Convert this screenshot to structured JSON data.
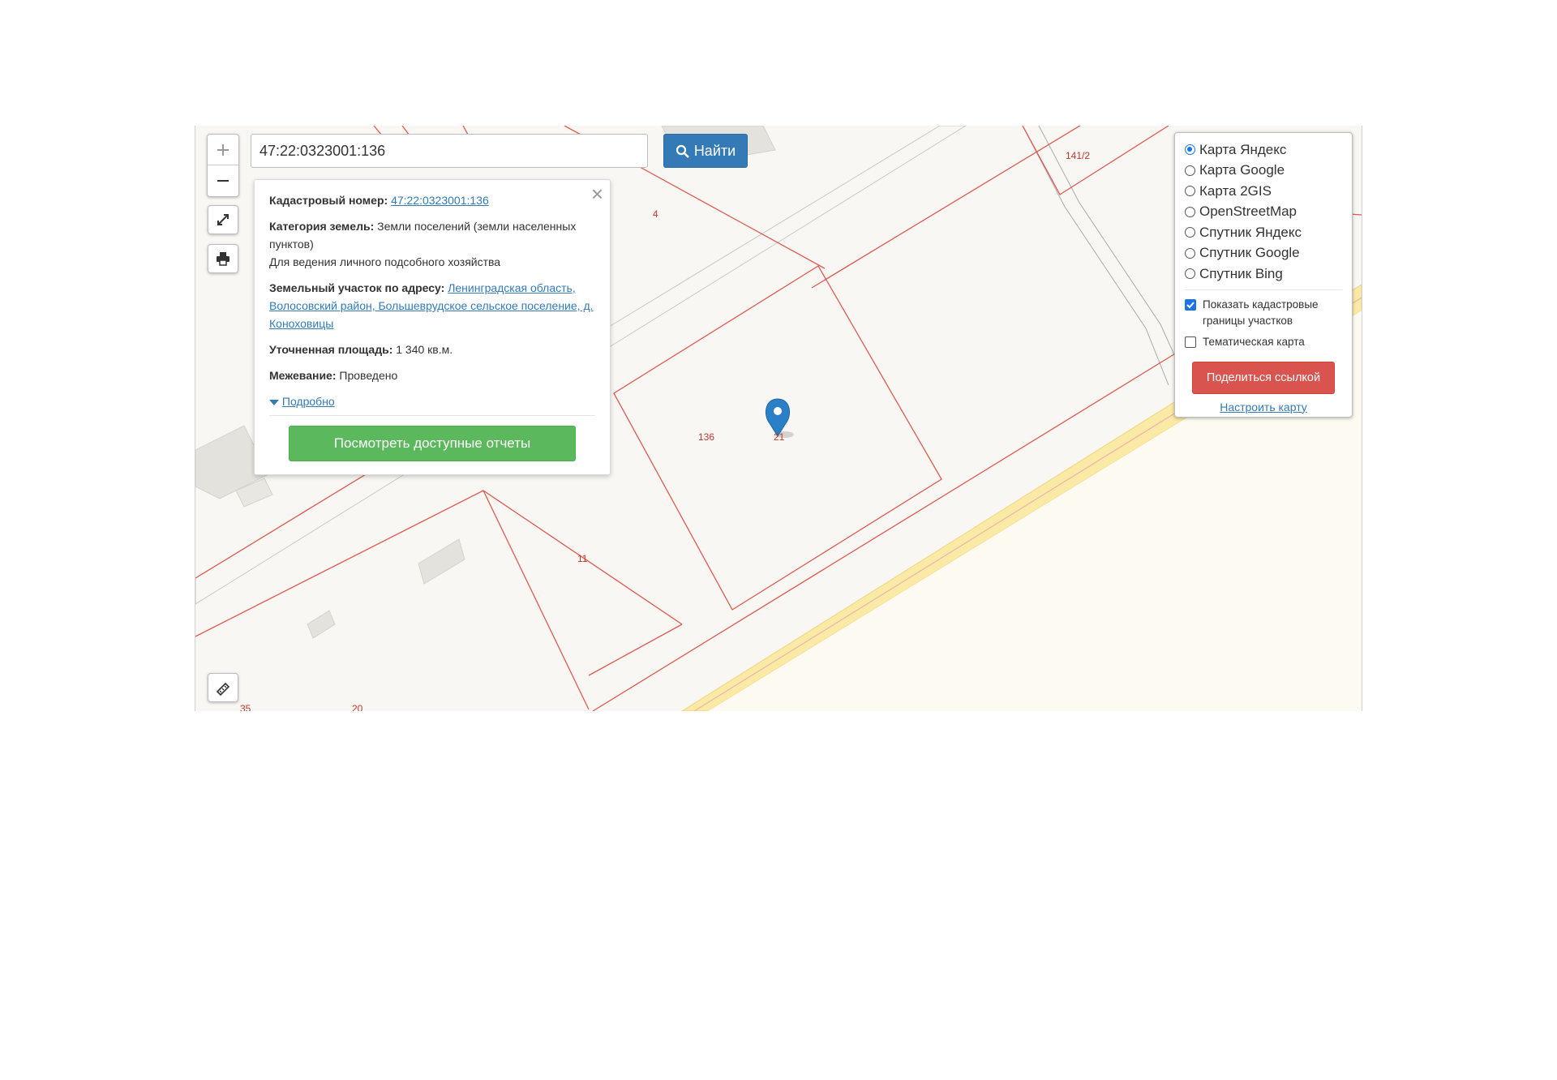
{
  "search": {
    "value": "47:22:0323001:136",
    "button_label": "Найти"
  },
  "popup": {
    "cadastral_label": "Кадастровый номер:",
    "cadastral_value": "47:22:0323001:136",
    "category_label": "Категория земель:",
    "category_value": "Земли поселений (земли населенных пунктов)",
    "usage_text": "Для ведения личного подсобного хозяйства",
    "address_label": "Земельный участок по адресу:",
    "address_value": "Ленинградская область, Волосовский район, Большеврудское сельское поселение, д. Коноховицы",
    "area_label": "Уточненная площадь:",
    "area_value": "1 340 кв.м.",
    "survey_label": "Межевание:",
    "survey_value": "Проведено",
    "details_link": "Подробно",
    "reports_button": "Посмотреть доступные отчеты"
  },
  "layers": {
    "options": [
      {
        "label": "Карта Яндекс",
        "checked": true
      },
      {
        "label": "Карта Google",
        "checked": false
      },
      {
        "label": "Карта 2GIS",
        "checked": false
      },
      {
        "label": "OpenStreetMap",
        "checked": false
      },
      {
        "label": "Спутник Яндекс",
        "checked": false
      },
      {
        "label": "Спутник Google",
        "checked": false
      },
      {
        "label": "Спутник Bing",
        "checked": false
      }
    ],
    "show_cadastral": "Показать кадастровые границы участков",
    "show_cadastral_checked": true,
    "thematic": "Тематическая карта",
    "thematic_checked": false,
    "share_button": "Поделиться ссылкой",
    "configure_link": "Настроить карту"
  },
  "map": {
    "parcel_labels": [
      "4",
      "141/2",
      "136",
      "21",
      "11",
      "20",
      "35"
    ],
    "parcel_color": "#e05a4f",
    "road_color": "#fbe9a6",
    "marker_color": "#2a7fc6"
  },
  "icons": {
    "zoom_in": "plus-icon",
    "zoom_out": "minus-icon",
    "fullscreen": "expand-icon",
    "print": "printer-icon",
    "ruler": "ruler-icon",
    "search": "search-icon",
    "close": "close-icon",
    "details": "caret-down-icon",
    "marker": "map-pin-icon"
  }
}
